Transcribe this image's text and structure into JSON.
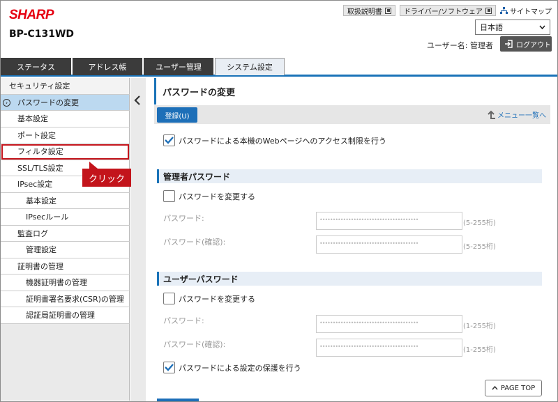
{
  "header": {
    "logo": "SHARP",
    "model": "BP-C131WD",
    "links": [
      "取扱説明書",
      "ドライバー/ソフトウェア"
    ],
    "sitemap": "サイトマップ",
    "language": "日本語",
    "user_label": "ユーザー名: 管理者",
    "logout": "ログアウト"
  },
  "tabs": [
    "ステータス",
    "アドレス帳",
    "ユーザー管理",
    "システム設定"
  ],
  "sidebar": {
    "items": [
      "セキュリティ設定",
      "パスワードの変更",
      "基本設定",
      "ポート設定",
      "フィルタ設定",
      "SSL/TLS設定",
      "IPsec設定",
      "基本設定",
      "IPsecルール",
      "監査ログ",
      "管理設定",
      "証明書の管理",
      "機器証明書の管理",
      "証明書署名要求(CSR)の管理",
      "認証局証明書の管理"
    ]
  },
  "callout": "クリック",
  "main": {
    "title": "パスワードの変更",
    "register": "登録(U)",
    "menu_link": "メニュー一覧へ",
    "restrict_access": "パスワードによる本機のWebページへのアクセス制限を行う",
    "admin_section": "管理者パスワード",
    "admin_change": "パスワードを変更する",
    "password_label": "パスワード:",
    "confirm_label": "パスワード(確認):",
    "admin_range": "(5-255桁)",
    "user_section": "ユーザーパスワード",
    "user_change": "パスワードを変更する",
    "user_range": "(1-255桁)",
    "protect_settings": "パスワードによる設定の保護を行う",
    "masked": "••••••••••••••••••••••••••••••••••••••",
    "page_top": "PAGE TOP"
  }
}
